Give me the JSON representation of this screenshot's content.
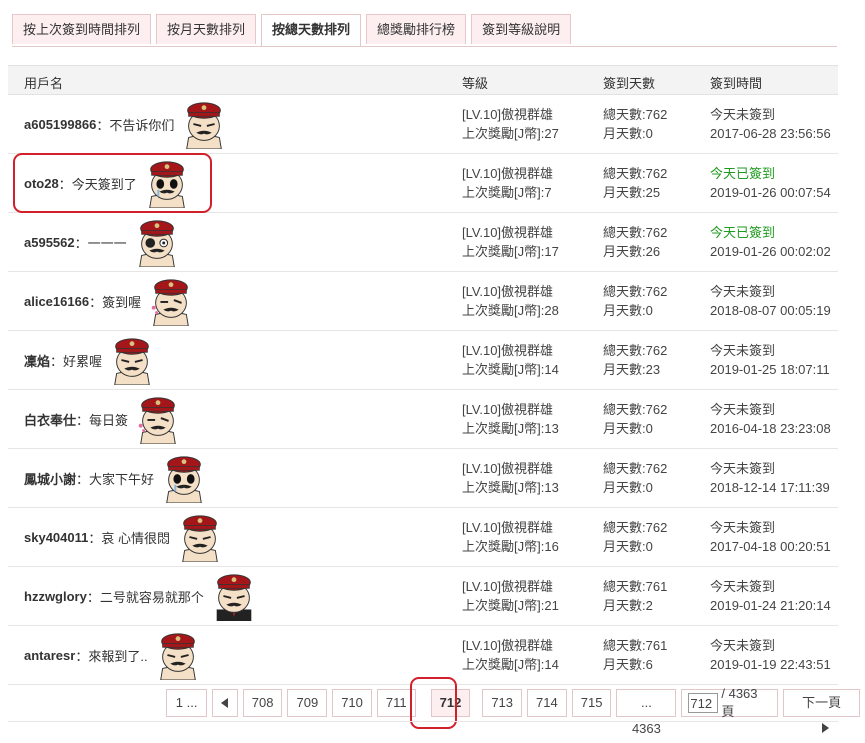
{
  "tabs": [
    "按上次簽到時間排列",
    "按月天數排列",
    "按總天數排列",
    "總獎勵排行榜",
    "簽到等級說明"
  ],
  "active_tab": 2,
  "columns": {
    "user": "用戶名",
    "level": "等級",
    "days": "簽到天數",
    "time": "簽到時間"
  },
  "rows": [
    {
      "user": "a605199866",
      "sep": "：",
      "msg": "不告诉你们",
      "level": "[LV.10]傲視群雄",
      "reward": "上次獎勵[J幣]:27",
      "total": "總天數:762",
      "month": "月天數:0",
      "status": "今天未簽到",
      "status_color": "#444444",
      "time": "2017-06-28 23:56:56",
      "avatar": "mustache-soldier-avatar"
    },
    {
      "user": "oto28",
      "sep": "：",
      "msg": "今天簽到了",
      "level": "[LV.10]傲視群雄",
      "reward": "上次獎勵[J幣]:7",
      "total": "總天數:762",
      "month": "月天數:25",
      "status": "今天已簽到",
      "status_color": "#1f9a1f",
      "time": "2019-01-26 00:07:54",
      "avatar": "crying-soldier-avatar"
    },
    {
      "user": "a595562",
      "sep": "：",
      "msg": "一一一",
      "level": "[LV.10]傲視群雄",
      "reward": "上次獎勵[J幣]:17",
      "total": "總天數:762",
      "month": "月天數:26",
      "status": "今天已簽到",
      "status_color": "#1f9a1f",
      "time": "2019-01-26 00:02:02",
      "avatar": "bruised-soldier-avatar"
    },
    {
      "user": "alice16166",
      "sep": "：",
      "msg": "簽到喔",
      "level": "[LV.10]傲視群雄",
      "reward": "上次獎勵[J幣]:28",
      "total": "總天數:762",
      "month": "月天數:0",
      "status": "今天未簽到",
      "status_color": "#444444",
      "time": "2018-08-07 00:05:19",
      "avatar": "winking-soldier-avatar"
    },
    {
      "user": "凜焰",
      "sep": "：",
      "msg": "好累喔",
      "level": "[LV.10]傲視群雄",
      "reward": "上次獎勵[J幣]:14",
      "total": "總天數:762",
      "month": "月天數:23",
      "status": "今天未簽到",
      "status_color": "#444444",
      "time": "2019-01-25 18:07:11",
      "avatar": "mustache-soldier-avatar"
    },
    {
      "user": "白衣奉仕",
      "sep": "：",
      "msg": "每日簽",
      "level": "[LV.10]傲視群雄",
      "reward": "上次獎勵[J幣]:13",
      "total": "總天數:762",
      "month": "月天數:0",
      "status": "今天未簽到",
      "status_color": "#444444",
      "time": "2016-04-18 23:23:08",
      "avatar": "winking-soldier-avatar"
    },
    {
      "user": "鳳城小謝",
      "sep": "：",
      "msg": "大家下午好",
      "level": "[LV.10]傲視群雄",
      "reward": "上次獎勵[J幣]:13",
      "total": "總天數:762",
      "month": "月天數:0",
      "status": "今天未簽到",
      "status_color": "#444444",
      "time": "2018-12-14 17:11:39",
      "avatar": "crying-soldier-avatar"
    },
    {
      "user": "sky404011",
      "sep": "：",
      "msg": "哀 心情很悶",
      "level": "[LV.10]傲視群雄",
      "reward": "上次獎勵[J幣]:16",
      "total": "總天數:762",
      "month": "月天數:0",
      "status": "今天未簽到",
      "status_color": "#444444",
      "time": "2017-04-18 00:20:51",
      "avatar": "mustache-soldier-avatar"
    },
    {
      "user": "hzzwglory",
      "sep": "：",
      "msg": "二号就容易就那个",
      "level": "[LV.10]傲視群雄",
      "reward": "上次獎勵[J幣]:21",
      "total": "總天數:761",
      "month": "月天數:2",
      "status": "今天未簽到",
      "status_color": "#444444",
      "time": "2019-01-24 21:20:14",
      "avatar": "suit-soldier-avatar"
    },
    {
      "user": "antaresr",
      "sep": "：",
      "msg": "來報到了..",
      "level": "[LV.10]傲視群雄",
      "reward": "上次獎勵[J幣]:14",
      "total": "總天數:761",
      "month": "月天數:6",
      "status": "今天未簽到",
      "status_color": "#444444",
      "time": "2019-01-19 22:43:51",
      "avatar": "yelling-soldier-avatar"
    }
  ],
  "pager": {
    "first": "1 ...",
    "prev_icon": "left-triangle-icon",
    "pages": [
      "708",
      "709",
      "710",
      "711",
      "712",
      "713",
      "714",
      "715"
    ],
    "current": "712",
    "last": "... 4363",
    "input_value": "712",
    "total": "/ 4363 頁",
    "next": "下一頁",
    "next_icon": "right-triangle-icon"
  },
  "colors": {
    "accent_red": "#d2202a",
    "tab_bg": "#fdeff0",
    "green": "#1f9a1f"
  }
}
